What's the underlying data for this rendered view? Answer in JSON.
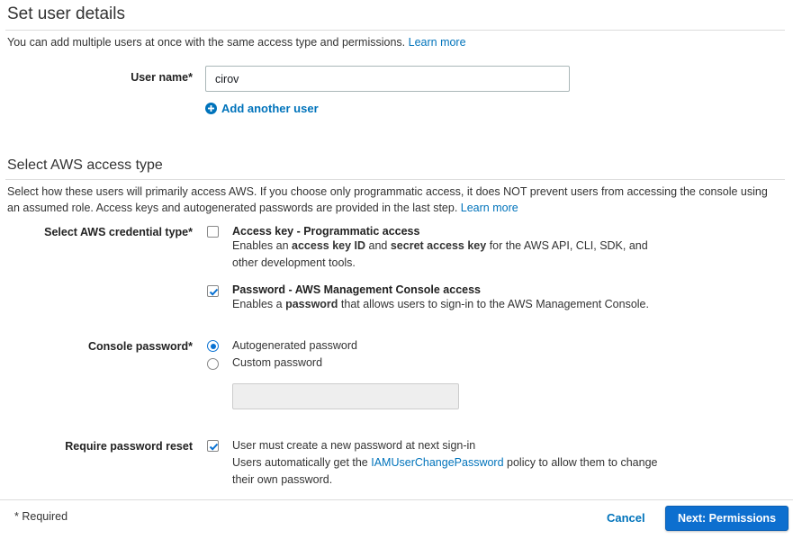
{
  "section1": {
    "title": "Set user details",
    "description": "You can add multiple users at once with the same access type and permissions.",
    "learn_more": "Learn more",
    "user_name_label": "User name*",
    "user_name_value": "cirov",
    "add_another_user": "Add another user"
  },
  "section2": {
    "title": "Select AWS access type",
    "description_line1": "Select how these users will primarily access AWS. If you choose only programmatic access, it does NOT prevent users from accessing the console using",
    "description_line2": "an assumed role. Access keys and autogenerated passwords are provided in the last step.",
    "learn_more": "Learn more",
    "credential_type_label": "Select AWS credential type*",
    "access_key": {
      "checked": false,
      "title": "Access key - Programmatic access",
      "desc_1": "Enables an ",
      "desc_b1": "access key ID",
      "desc_2": " and ",
      "desc_b2": "secret access key",
      "desc_3": " for the AWS API, CLI, SDK, and",
      "desc_4": "other development tools."
    },
    "console_access": {
      "checked": true,
      "title": "Password - AWS Management Console access",
      "desc_1": "Enables a ",
      "desc_b1": "password",
      "desc_2": " that allows users to sign-in to the AWS Management Console."
    },
    "console_password_label": "Console password*",
    "password_options": [
      {
        "label": "Autogenerated password",
        "selected": true
      },
      {
        "label": "Custom password",
        "selected": false
      }
    ],
    "custom_password_value": "",
    "require_reset_label": "Require password reset",
    "require_reset": {
      "checked": true,
      "line1": "User must create a new password at next sign-in",
      "line2_a": "Users automatically get the ",
      "line2_link": "IAMUserChangePassword",
      "line2_b": " policy to allow them to change",
      "line3": "their own password."
    }
  },
  "footer": {
    "required_note": "* Required",
    "cancel": "Cancel",
    "next": "Next: Permissions"
  },
  "colors": {
    "link": "#0073bb",
    "primary_button": "#0d6fcf",
    "checkbox": "#0972d3"
  }
}
